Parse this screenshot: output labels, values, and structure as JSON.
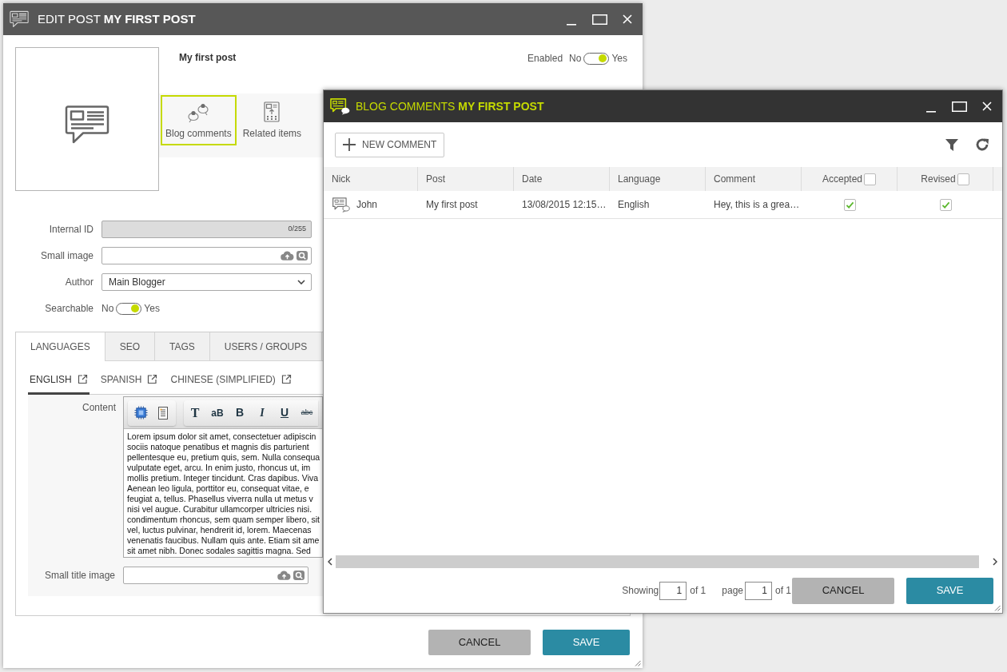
{
  "edit_post_window": {
    "title": "EDIT POST **MY FIRST POST**",
    "post_name": "My first post",
    "enabled": {
      "label": "Enabled",
      "off_label": "No",
      "on_label": "Yes",
      "on": true
    },
    "actions": [
      {
        "label": "Blog comments",
        "kind": "comments",
        "selected": true
      },
      {
        "label": "Related items",
        "kind": "related",
        "selected": false
      }
    ],
    "fields": [
      {
        "kind": "counter",
        "label": "Internal ID",
        "counter": "0/255",
        "disabled": true
      },
      {
        "kind": "file",
        "label": "Small image",
        "disabled": false
      },
      {
        "kind": "select",
        "label": "Author",
        "value": "Main Blogger",
        "disabled": false
      },
      {
        "kind": "toggle",
        "label": "Searchable",
        "off_label": "No",
        "on_label": "Yes",
        "on": true
      }
    ],
    "tabs": [
      {
        "label": "LANGUAGES",
        "selected": true
      },
      {
        "label": "SEO",
        "selected": false
      },
      {
        "label": "TAGS",
        "selected": false
      },
      {
        "label": "USERS / GROUPS",
        "selected": false
      }
    ],
    "language_tabs": [
      {
        "label": "ENGLISH",
        "selected": true
      },
      {
        "label": "SPANISH",
        "selected": false
      },
      {
        "label": "CHINESE (SIMPLIFIED)",
        "selected": false
      }
    ],
    "content": {
      "label": "Content",
      "toolbar": [
        {
          "label": "T",
          "kind": "clear"
        },
        {
          "label": "aB",
          "kind": "case"
        },
        {
          "label": "B",
          "kind": "bold"
        },
        {
          "label": "I",
          "kind": "italic"
        },
        {
          "label": "U",
          "kind": "underline"
        },
        {
          "label": "abc",
          "kind": "strike"
        }
      ],
      "lines": [
        "Lorem ipsum dolor sit amet, consectetuer adipiscin",
        "sociis natoque penatibus et magnis dis parturient",
        "pellentesque eu, pretium quis, sem. Nulla consequa",
        "vulputate eget, arcu. In enim justo, rhoncus ut, im",
        "mollis pretium. Integer tincidunt. Cras dapibus. Viva",
        "Aenean leo ligula, porttitor eu, consequat vitae, e",
        "feugiat a, tellus. Phasellus viverra nulla ut metus v",
        "nisi vel augue. Curabitur ullamcorper ultricies nisi.",
        "condimentum rhoncus, sem quam semper libero, sit",
        "vel, luctus pulvinar, hendrerit id, lorem. Maecenas",
        "venenatis faucibus. Nullam quis ante. Etiam sit ame",
        "sit amet nibh. Donec sodales sagittis magna. Sed"
      ]
    },
    "title_image": {
      "label": "Small title image"
    },
    "buttons": [
      {
        "label": "CANCEL",
        "kind": "secondary"
      },
      {
        "label": "SAVE",
        "kind": "primary"
      }
    ]
  },
  "comments_window": {
    "title": "BLOG COMMENTS **MY FIRST POST**",
    "new_button": "NEW COMMENT",
    "table": {
      "columns": [
        {
          "label": "Nick",
          "kind": "icon_text"
        },
        {
          "label": "Post",
          "kind": "text"
        },
        {
          "label": "Date",
          "kind": "text"
        },
        {
          "label": "Language",
          "kind": "text"
        },
        {
          "label": "Comment",
          "kind": "text"
        },
        {
          "label": "Accepted",
          "kind": "check",
          "checked": false
        },
        {
          "label": "Revised",
          "kind": "check",
          "checked": false
        }
      ],
      "rows": [
        {
          "cells": [
            {
              "text": "John"
            },
            {
              "text": "My first post"
            },
            {
              "text": "13/08/2015 12:15…"
            },
            {
              "text": "English"
            },
            {
              "text": "Hey, this is a grea…"
            },
            {
              "checked": true
            },
            {
              "checked": true
            }
          ]
        }
      ]
    },
    "pager": {
      "showing_label": "Showing",
      "showing_value": "1",
      "showing_total": "of 1",
      "page_label": "page",
      "page_value": "1",
      "page_total": "of 1"
    },
    "buttons": [
      {
        "label": "CANCEL",
        "kind": "secondary"
      },
      {
        "label": "SAVE",
        "kind": "primary"
      }
    ]
  }
}
